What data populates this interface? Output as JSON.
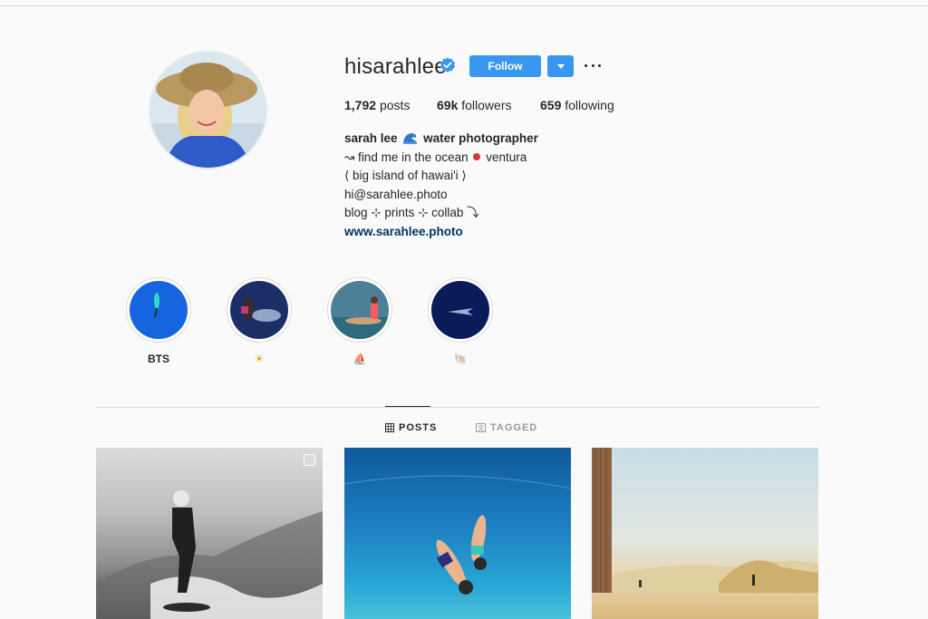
{
  "profile": {
    "username": "hisarahlee",
    "follow_label": "Follow",
    "stats": {
      "posts_count": "1,792",
      "posts_label": "posts",
      "followers_count": "69k",
      "followers_label": "followers",
      "following_count": "659",
      "following_label": "following"
    },
    "bio": {
      "name": "sarah lee",
      "title": "water photographer",
      "line1_pre": "↝ find me in the ocean",
      "line1_post": "ventura",
      "line2": "⟨ big island of hawai'i ⟩",
      "line3": "hi@sarahlee.photo",
      "line4": "blog ⊹ prints ⊹ collab ⤵",
      "link": "www.sarahlee.photo"
    }
  },
  "highlights": [
    {
      "label": "BTS"
    },
    {
      "label": "☀"
    },
    {
      "label": "⛵"
    },
    {
      "label": "🐚"
    }
  ],
  "tabs": {
    "posts": "POSTS",
    "tagged": "TAGGED"
  },
  "colors": {
    "accent": "#3897f0",
    "link": "#003569",
    "background": "#fafafa"
  },
  "icons": [
    "verified-icon",
    "chevron-down-icon",
    "more-icon",
    "wave-icon",
    "pin-icon",
    "grid-icon",
    "tagged-icon",
    "multiple-posts-icon"
  ]
}
